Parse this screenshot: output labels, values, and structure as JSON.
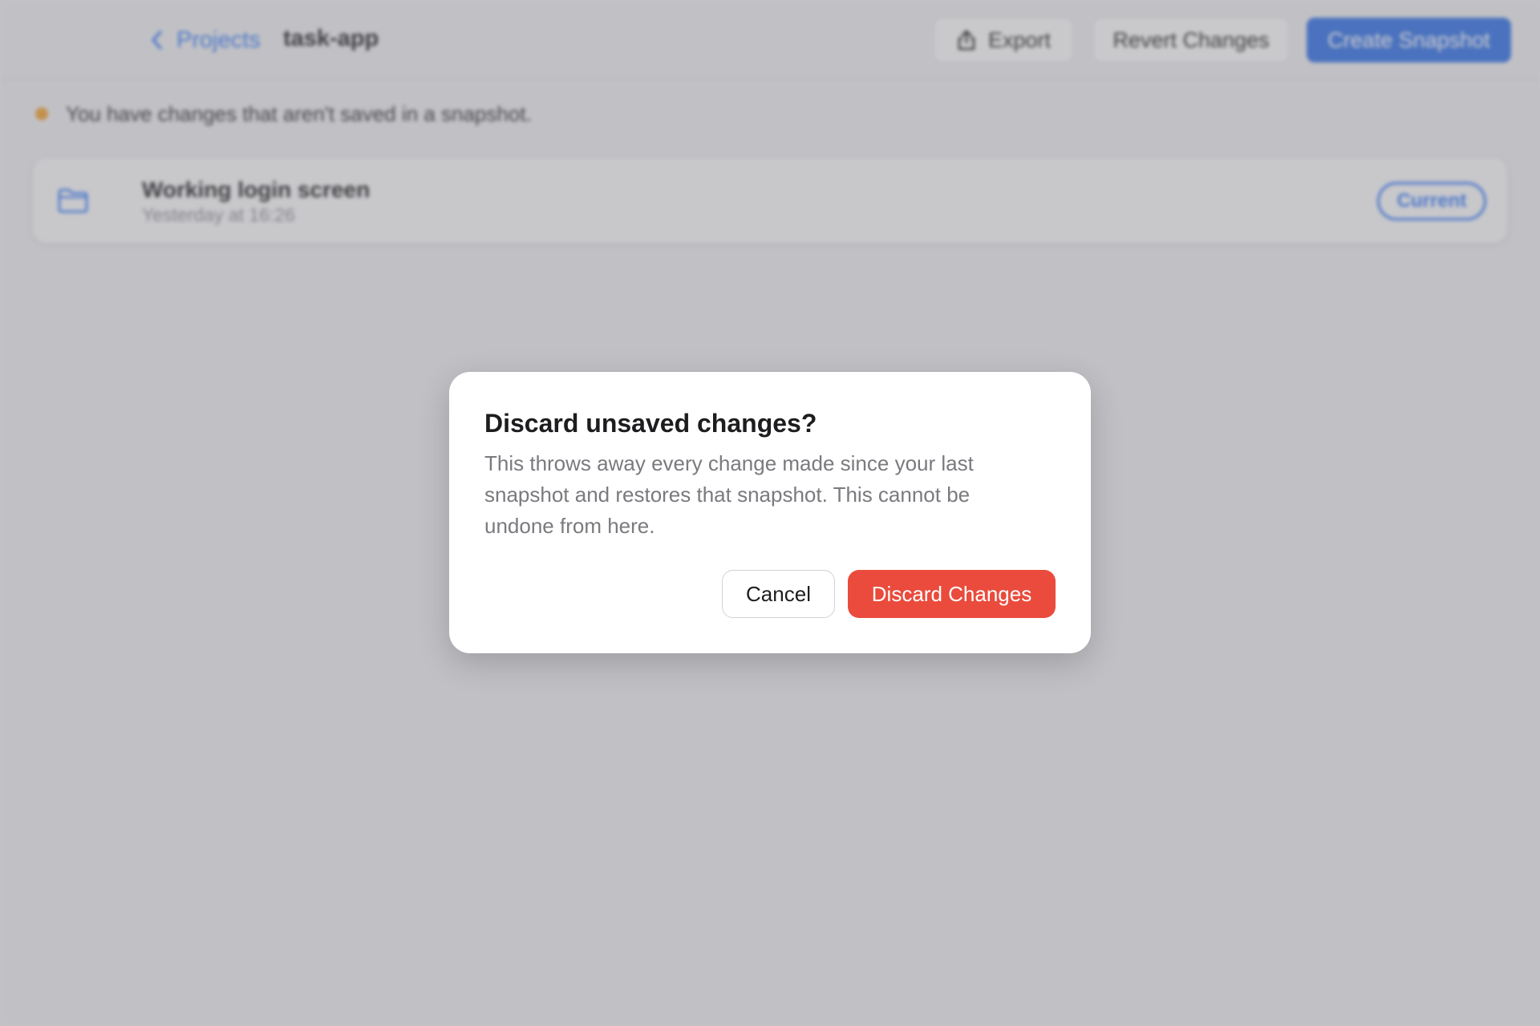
{
  "header": {
    "back_label": "Projects",
    "project_name": "task-app",
    "export_label": "Export",
    "revert_label": "Revert Changes",
    "create_snapshot_label": "Create Snapshot"
  },
  "notice": {
    "text": "You have changes that aren't saved in a snapshot.",
    "dot_color": "#f0a030"
  },
  "snapshots": [
    {
      "title": "Working login screen",
      "time": "Yesterday at 16:26",
      "badge": "Current"
    }
  ],
  "dialog": {
    "title": "Discard unsaved changes?",
    "body": "This throws away every change made since your last snapshot and restores that snapshot. This cannot be undone from here.",
    "cancel_label": "Cancel",
    "confirm_label": "Discard Changes",
    "confirm_color": "#ea4b3c"
  },
  "colors": {
    "accent": "#3478f6",
    "primary_button": "#2f6fe6"
  }
}
